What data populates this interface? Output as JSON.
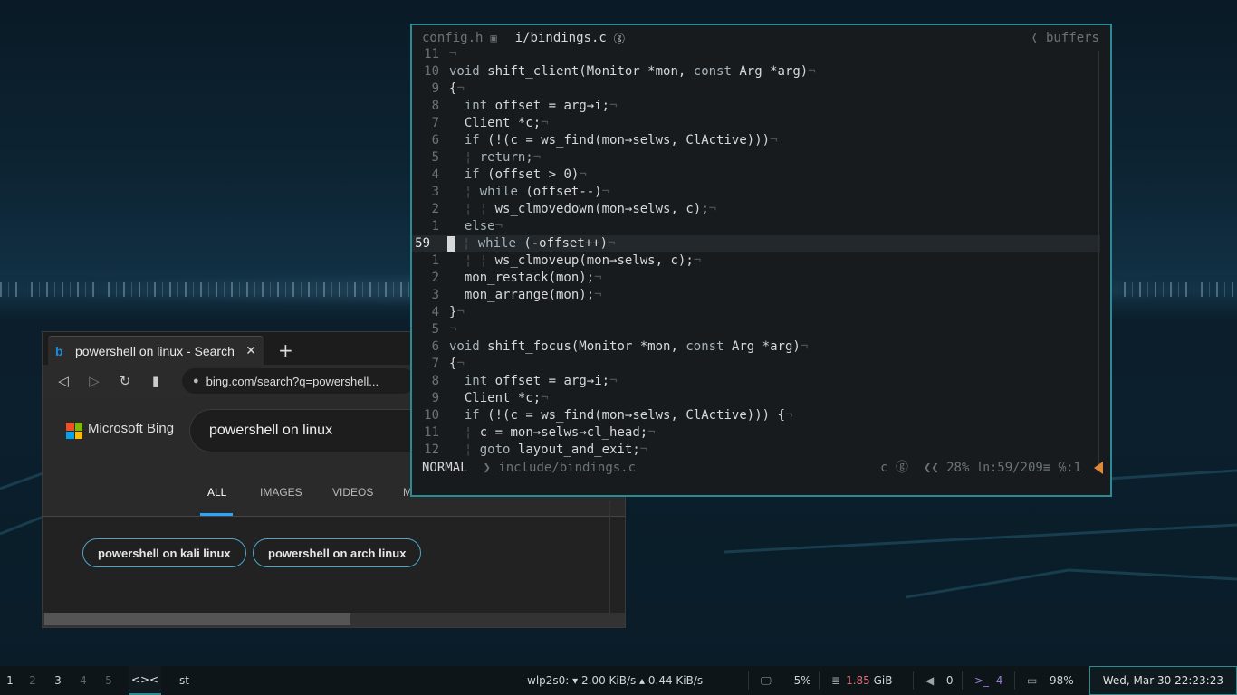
{
  "browser": {
    "tab_title": "powershell on linux - Search",
    "tab_close": "✕",
    "new_tab": "+",
    "url": "bing.com/search?q=powershell...",
    "brand": "Microsoft Bing",
    "query": "powershell on linux",
    "scopes": [
      "ALL",
      "IMAGES",
      "VIDEOS",
      "M"
    ],
    "active_scope": "ALL",
    "suggestions": [
      "powershell on kali linux",
      "powershell on arch linux"
    ]
  },
  "vim": {
    "tab1": "config.h",
    "tab2": "i/bindings.c",
    "buffers_label": "buffers",
    "mode": "NORMAL",
    "file": "include/bindings.c",
    "status_right": "c ⓖ  ❮❮ 28% ㏑:59/209≡ ℅:1",
    "lines": [
      {
        "n": "11",
        "text": "",
        "cur": false
      },
      {
        "n": "10",
        "text": "void shift_client(Monitor *mon, const Arg *arg)",
        "cur": false
      },
      {
        "n": "9",
        "text": "{",
        "cur": false
      },
      {
        "n": "8",
        "text": "  int offset = arg→i;",
        "cur": false
      },
      {
        "n": "7",
        "text": "  Client *c;",
        "cur": false
      },
      {
        "n": "6",
        "text": "  if (!(c = ws_find(mon→selws, ClActive)))",
        "cur": false
      },
      {
        "n": "5",
        "text": "  ¦ return;",
        "cur": false
      },
      {
        "n": "4",
        "text": "  if (offset > 0)",
        "cur": false
      },
      {
        "n": "3",
        "text": "  ¦ while (offset--)",
        "cur": false
      },
      {
        "n": "2",
        "text": "  ¦ ¦ ws_clmovedown(mon→selws, c);",
        "cur": false
      },
      {
        "n": "1",
        "text": "  else",
        "cur": false
      },
      {
        "n": "59",
        "text": "  ¦ while (-offset++)",
        "cur": true
      },
      {
        "n": "1",
        "text": "  ¦ ¦ ws_clmoveup(mon→selws, c);",
        "cur": false
      },
      {
        "n": "2",
        "text": "  mon_restack(mon);",
        "cur": false
      },
      {
        "n": "3",
        "text": "  mon_arrange(mon);",
        "cur": false
      },
      {
        "n": "4",
        "text": "}",
        "cur": false
      },
      {
        "n": "5",
        "text": "",
        "cur": false
      },
      {
        "n": "6",
        "text": "void shift_focus(Monitor *mon, const Arg *arg)",
        "cur": false
      },
      {
        "n": "7",
        "text": "{",
        "cur": false
      },
      {
        "n": "8",
        "text": "  int offset = arg→i;",
        "cur": false
      },
      {
        "n": "9",
        "text": "  Client *c;",
        "cur": false
      },
      {
        "n": "10",
        "text": "  if (!(c = ws_find(mon→selws, ClActive))) {",
        "cur": false
      },
      {
        "n": "11",
        "text": "  ¦ c = mon→selws→cl_head;",
        "cur": false
      },
      {
        "n": "12",
        "text": "  ¦ goto layout_and_exit;",
        "cur": false
      }
    ],
    "eol_char": "¬"
  },
  "bar": {
    "workspaces": [
      "1",
      "2",
      "3",
      "4",
      "5"
    ],
    "occupied": [
      "1",
      "3"
    ],
    "layout": "<><",
    "window_title": "st",
    "net": "wlp2s0: ▾ 2.00 KiB/s ▴ 0.44 KiB/s",
    "cpu": "5%",
    "mem": "1.85",
    "mem_unit": "GiB",
    "vol": "0",
    "term_count": "4",
    "term_prompt": ">_",
    "battery": "98%",
    "clock": "Wed, Mar 30 22:23:23"
  },
  "colors": {
    "accent": "#2b8a93",
    "bing_blue": "#2aa6ff",
    "mem": "#e06c75"
  }
}
